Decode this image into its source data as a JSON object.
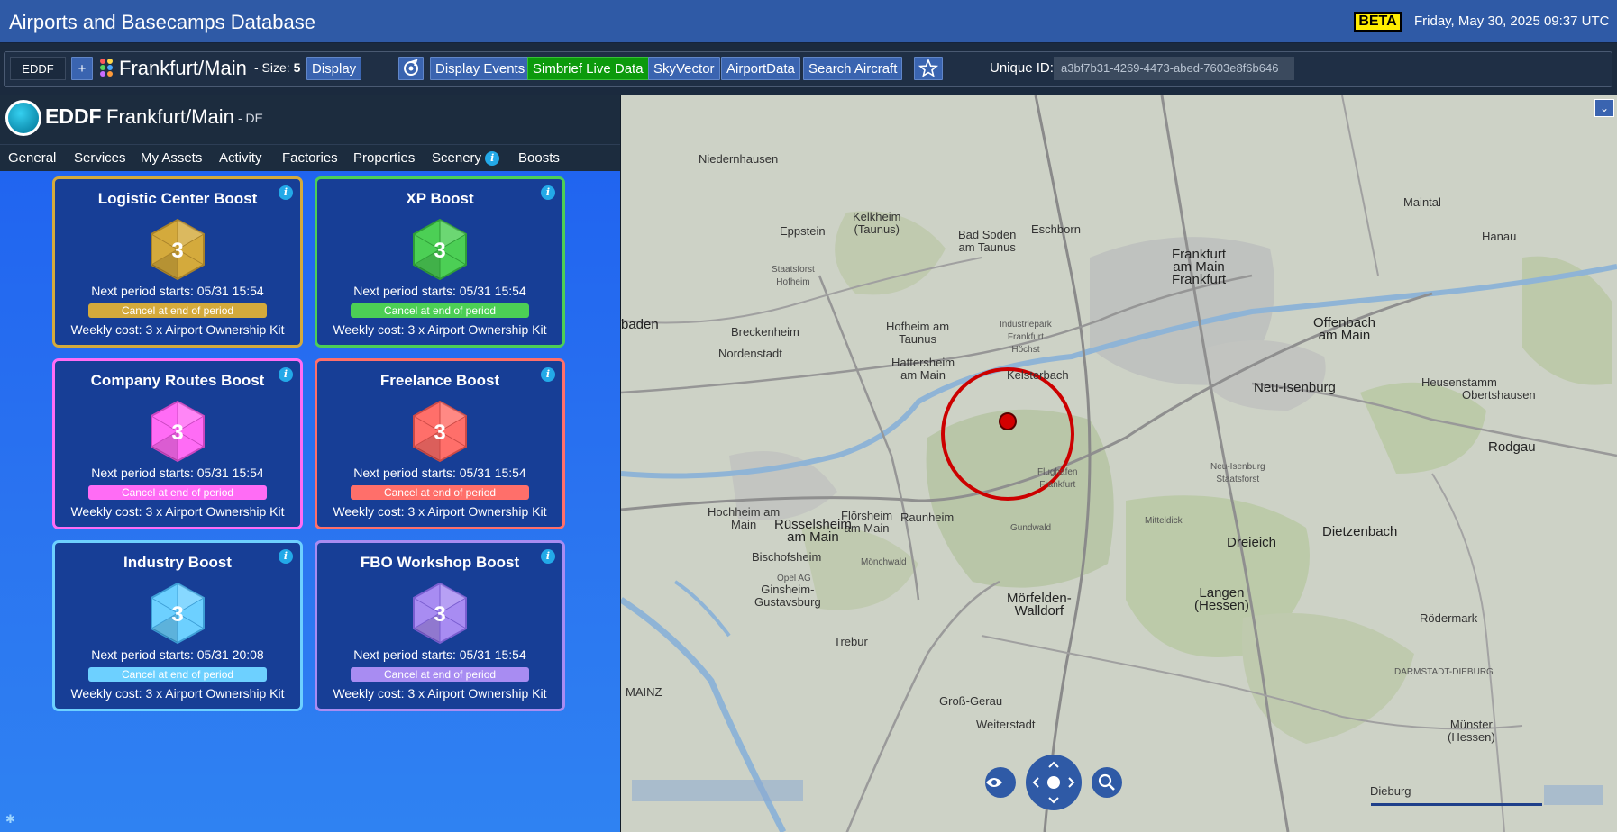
{
  "window": {
    "title": "Airports and Basecamps Database",
    "beta_badge": "BETA",
    "datetime": "Friday, May 30, 2025 09:37 UTC"
  },
  "toolbar": {
    "icao_value": "EDDF",
    "add_label": "+",
    "airport_name": "Frankfurt/Main",
    "size_prefix": "- Size:",
    "size_value": "5",
    "display_label": "Display",
    "display_events_label": "Display Events",
    "simbrief_label": "Simbrief Live Data",
    "skyvector_label": "SkyVector",
    "airportdata_label": "AirportData",
    "search_aircraft_label": "Search Aircraft",
    "unique_id_label": "Unique ID:",
    "unique_id_value": "a3bf7b31-4269-4473-abed-7603e8f6b646"
  },
  "airport": {
    "icao": "EDDF",
    "name": "Frankfurt/Main",
    "country": "- DE"
  },
  "tabs": [
    "General",
    "Services",
    "My Assets",
    "Activity",
    "Factories",
    "Properties",
    "Scenery",
    "Boosts"
  ],
  "boosts": [
    {
      "title": "Logistic Center Boost",
      "level": "3",
      "next": "Next period starts: 05/31 15:54",
      "cancel": "Cancel at end of period",
      "cost": "Weekly cost: 3 x Airport Ownership Kit",
      "color": "#d4aa3c",
      "dark": "#a8822a"
    },
    {
      "title": "XP Boost",
      "level": "3",
      "next": "Next period starts: 05/31 15:54",
      "cancel": "Cancel at end of period",
      "cost": "Weekly cost: 3 x Airport Ownership Kit",
      "color": "#4ccf55",
      "dark": "#2f9e38"
    },
    {
      "title": "Company Routes Boost",
      "level": "3",
      "next": "Next period starts: 05/31 15:54",
      "cancel": "Cancel at end of period",
      "cost": "Weekly cost: 3 x Airport Ownership Kit",
      "color": "#ff6cf5",
      "dark": "#c946c0"
    },
    {
      "title": "Freelance Boost",
      "level": "3",
      "next": "Next period starts: 05/31 15:54",
      "cancel": "Cancel at end of period",
      "cost": "Weekly cost: 3 x Airport Ownership Kit",
      "color": "#ff6f6a",
      "dark": "#cc4a46"
    },
    {
      "title": "Industry Boost",
      "level": "3",
      "next": "Next period starts: 05/31 20:08",
      "cancel": "Cancel at end of period",
      "cost": "Weekly cost: 3 x Airport Ownership Kit",
      "color": "#6dd0ff",
      "dark": "#3d9ed6"
    },
    {
      "title": "FBO Workshop Boost",
      "level": "3",
      "next": "Next period starts: 05/31 15:54",
      "cancel": "Cancel at end of period",
      "cost": "Weekly cost: 3 x Airport Ownership Kit",
      "color": "#a88cf2",
      "dark": "#7a5ed0"
    }
  ],
  "map": {
    "labels": [
      {
        "text": "Niedernhausen",
        "cls": "mid"
      },
      {
        "text": "Kelkheim\n(Taunus)",
        "cls": "mid"
      },
      {
        "text": "Eppstein",
        "cls": "mid"
      },
      {
        "text": "Bad Soden\nam Taunus",
        "cls": "mid"
      },
      {
        "text": "Eschborn",
        "cls": "mid"
      },
      {
        "text": "Frankfurt\nam Main\nFrankfurt",
        "cls": "big"
      },
      {
        "text": "Maintal",
        "cls": "mid"
      },
      {
        "text": "Hanau",
        "cls": "mid"
      },
      {
        "text": "Offenbach\nam Main",
        "cls": "big"
      },
      {
        "text": "Hofheim am\nTaunus",
        "cls": "mid"
      },
      {
        "text": "Industriepark\nFrankfurt\nHöchst",
        "cls": "small"
      },
      {
        "text": "Breckenheim",
        "cls": "mid"
      },
      {
        "text": "Nordenstadt",
        "cls": "mid"
      },
      {
        "text": "Hattersheim\nam Main",
        "cls": "mid"
      },
      {
        "text": "Kelsterbach",
        "cls": "mid"
      },
      {
        "text": "Neu-Isenburg",
        "cls": "big"
      },
      {
        "text": "Heusenstamm",
        "cls": "mid"
      },
      {
        "text": "Obertshausen",
        "cls": "mid"
      },
      {
        "text": "Rodgau",
        "cls": "big"
      },
      {
        "text": "Hochheim am\nMain",
        "cls": "mid"
      },
      {
        "text": "Flörsheim\nam Main",
        "cls": "mid"
      },
      {
        "text": "Raunheim",
        "cls": "mid"
      },
      {
        "text": "Rüsselsheim\nam Main",
        "cls": "big"
      },
      {
        "text": "Dreieich",
        "cls": "big"
      },
      {
        "text": "Dietzenbach",
        "cls": "big"
      },
      {
        "text": "Bischofsheim",
        "cls": "mid"
      },
      {
        "text": "Ginsheim-\nGustavsburg",
        "cls": "mid"
      },
      {
        "text": "Mörfelden-\nWalldorf",
        "cls": "big"
      },
      {
        "text": "Langen\n(Hessen)",
        "cls": "big"
      },
      {
        "text": "Rödermark",
        "cls": "mid"
      },
      {
        "text": "Trebur",
        "cls": "mid"
      },
      {
        "text": "Groß-Gerau",
        "cls": "mid"
      },
      {
        "text": "Weiterstadt",
        "cls": "mid"
      },
      {
        "text": "Münster\n(Hessen)",
        "cls": "mid"
      },
      {
        "text": "Dieburg",
        "cls": "mid"
      },
      {
        "text": "Flughafen\nFrankfurt",
        "cls": "small"
      },
      {
        "text": "Gundwald",
        "cls": "small"
      },
      {
        "text": "Mitteldick",
        "cls": "small"
      },
      {
        "text": "baden",
        "cls": "big"
      },
      {
        "text": "MAINZ",
        "cls": "mid"
      },
      {
        "text": "DARMSTADT-DIEBURG",
        "cls": "small"
      },
      {
        "text": "Staatsforst\nHofheim",
        "cls": "small"
      },
      {
        "text": "Mönchwald",
        "cls": "small"
      },
      {
        "text": "Neu-Isenburg\nStaatsforst",
        "cls": "small"
      },
      {
        "text": "Opel AG",
        "cls": "small"
      }
    ],
    "collapse_icon": "chevron-down-icon"
  }
}
